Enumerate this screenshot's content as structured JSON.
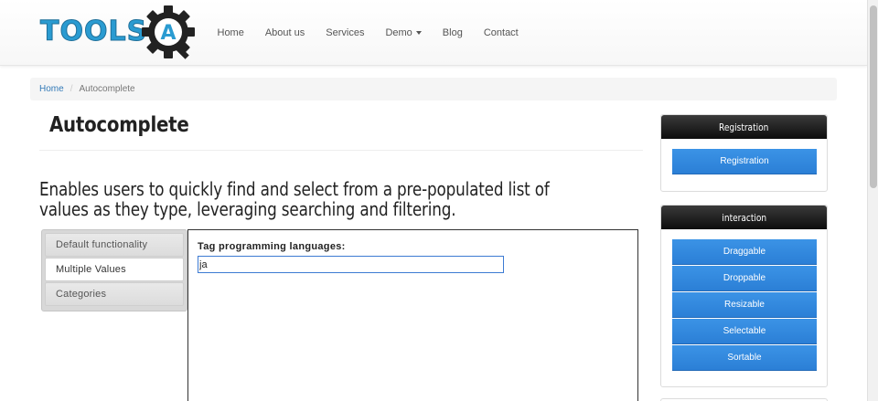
{
  "header": {
    "logo_text": "TOOLS",
    "logo_badge": "A",
    "nav": [
      {
        "label": "Home"
      },
      {
        "label": "About us"
      },
      {
        "label": "Services"
      },
      {
        "label": "Demo"
      },
      {
        "label": "Blog"
      },
      {
        "label": "Contact"
      }
    ]
  },
  "breadcrumb": {
    "home": "Home",
    "separator": "/",
    "current": "Autocomplete"
  },
  "main": {
    "title": "Autocomplete",
    "lead": "Enables users to quickly find and select from a pre-populated list of values as they type, leveraging searching and filtering.",
    "tabs": [
      {
        "label": "Default functionality"
      },
      {
        "label": "Multiple Values"
      },
      {
        "label": "Categories"
      }
    ],
    "active_tab": "Multiple Values",
    "field_label": "Tag programming languages:",
    "field_value": "ja"
  },
  "sidebar": {
    "registration": {
      "heading": "Registration",
      "button": "Registration"
    },
    "interaction": {
      "heading": "interaction",
      "buttons": [
        "Draggable",
        "Droppable",
        "Resizable",
        "Selectable",
        "Sortable"
      ]
    }
  },
  "colors": {
    "brand": "#2a9bd1",
    "button": "#2b7fd6",
    "link": "#337ab7"
  }
}
